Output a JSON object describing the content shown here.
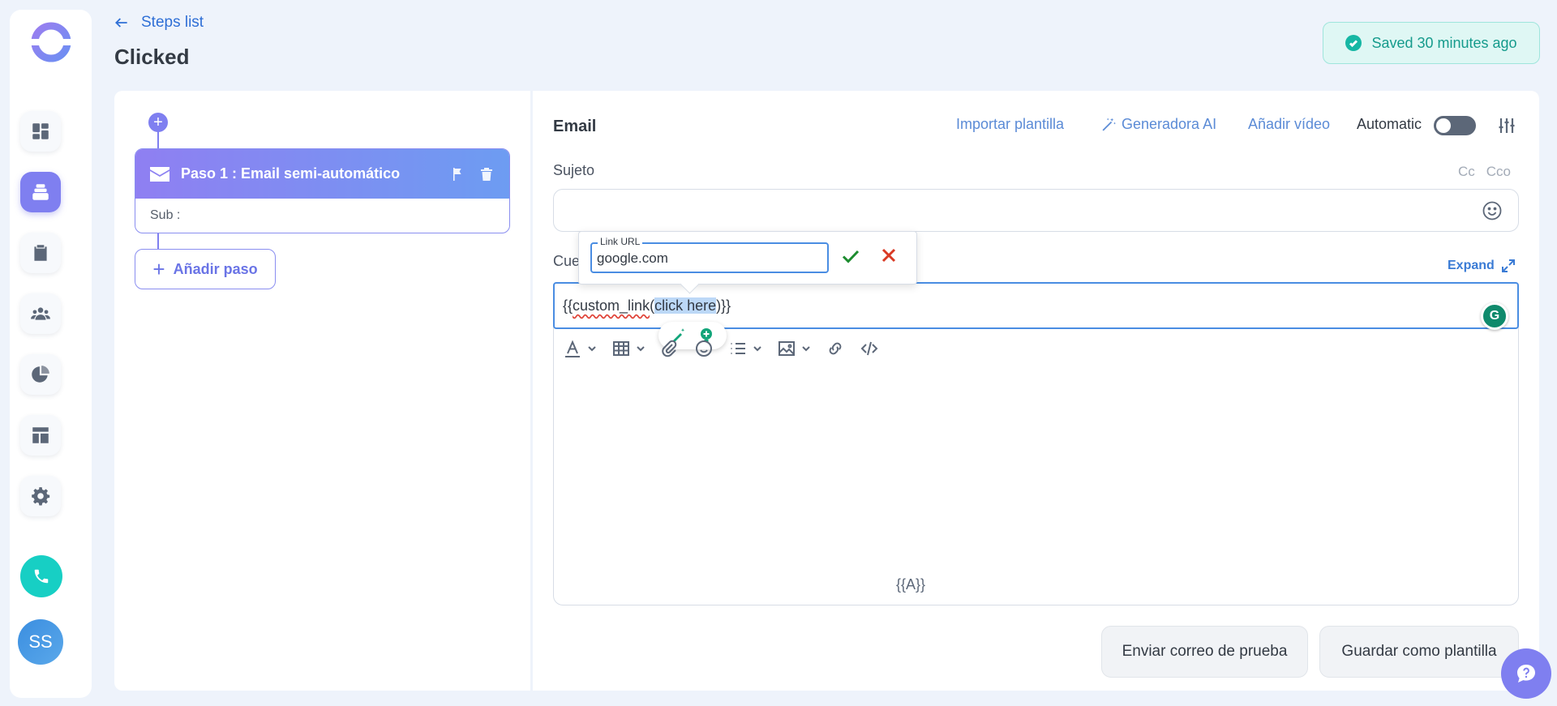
{
  "header": {
    "back_label": "Steps list",
    "page_title": "Clicked",
    "saved_status": "Saved 30 minutes ago"
  },
  "sidebar": {
    "items": [
      {
        "name": "dashboard"
      },
      {
        "name": "sequences",
        "active": true
      },
      {
        "name": "tasks"
      },
      {
        "name": "contacts"
      },
      {
        "name": "reports"
      },
      {
        "name": "templates"
      },
      {
        "name": "settings"
      }
    ],
    "avatar_initials": "SS"
  },
  "steps": {
    "step_title": "Paso 1 : Email semi-automático",
    "step_sub": "Sub :",
    "add_step_label": "Añadir paso"
  },
  "editor": {
    "section_label": "Email",
    "import_template": "Importar plantilla",
    "ai_generator": "Generadora AI",
    "add_video": "Añadir vídeo",
    "automatic_label": "Automatic",
    "subject_label": "Sujeto",
    "cc_label": "Cc",
    "bcc_label": "Cco",
    "body_label": "Cue",
    "expand_label": "Expand",
    "body_text_before": "{{",
    "body_text_word": "custom_link",
    "body_text_paren": "(",
    "body_text_selected": "click here",
    "body_text_after": ")}}",
    "footer_variable": "{{A}}",
    "link_popover": {
      "legend": "Link URL",
      "value": "google.com"
    },
    "test_email_button": "Enviar correo de prueba",
    "save_template_button": "Guardar como plantilla"
  },
  "colors": {
    "accent": "#7f7ff0",
    "link": "#2f6fd6",
    "saved_bg": "#dff7f4",
    "saved_text": "#159b8c"
  }
}
